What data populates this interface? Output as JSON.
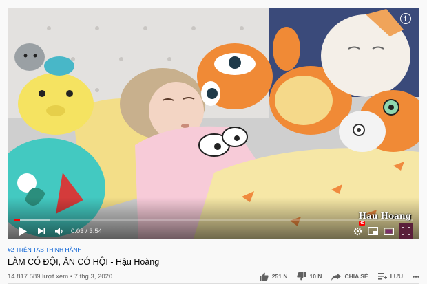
{
  "video": {
    "watermark": "Hau Hoang",
    "current_time": "0:03",
    "duration": "3:54",
    "time_separator": " / ",
    "progress": 0.013,
    "buffered": 0.09
  },
  "meta": {
    "hashtag": "#2 TRÊN TAB THỊNH HÀNH",
    "title": "LÀM CÓ ĐỘI, ĂN CÓ HỘI - Hậu Hoàng",
    "views": "14.817.589 lượt xem • 7 thg 3, 2020"
  },
  "actions": {
    "like_count": "251 N",
    "dislike_count": "10 N",
    "share_label": "CHIA SẺ",
    "save_label": "LƯU"
  },
  "icons": [
    "info-icon",
    "play-icon",
    "next-icon",
    "volume-icon",
    "settings-icon",
    "miniplayer-icon",
    "theater-icon",
    "fullscreen-icon",
    "like-icon",
    "dislike-icon",
    "share-icon",
    "save-icon",
    "more-icon"
  ],
  "colors": {
    "accent": "#ff0000",
    "link": "#065fd4"
  }
}
